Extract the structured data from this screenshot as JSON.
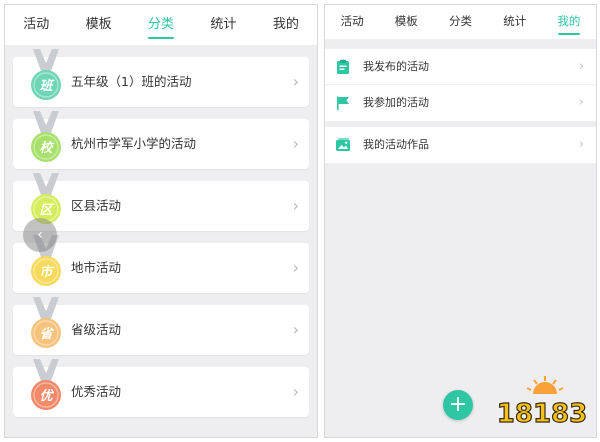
{
  "left_panel": {
    "tabs": [
      {
        "label": "活动"
      },
      {
        "label": "模板"
      },
      {
        "label": "分类",
        "active": true
      },
      {
        "label": "统计"
      },
      {
        "label": "我的"
      }
    ],
    "categories": [
      {
        "label": "五年级（1）班的活动",
        "badge": "班",
        "color": "#6ed6b6",
        "ribbon": "#c9ccd1"
      },
      {
        "label": "杭州市学军小学的活动",
        "badge": "校",
        "color": "#a7e06a",
        "ribbon": "#c9ccd1"
      },
      {
        "label": "区县活动",
        "badge": "区",
        "color": "#d6ec5f",
        "ribbon": "#c9ccd1"
      },
      {
        "label": "地市活动",
        "badge": "市",
        "color": "#f7d95b",
        "ribbon": "#c9ccd1"
      },
      {
        "label": "省级活动",
        "badge": "省",
        "color": "#f7c27c",
        "ribbon": "#c9ccd1"
      },
      {
        "label": "优秀活动",
        "badge": "优",
        "color": "#f28a6a",
        "ribbon": "#c9ccd1"
      }
    ],
    "chevron": "›",
    "handle_glyph": "‹"
  },
  "right_panel": {
    "tabs": [
      {
        "label": "活动"
      },
      {
        "label": "模板"
      },
      {
        "label": "分类"
      },
      {
        "label": "统计"
      },
      {
        "label": "我的",
        "active": true
      }
    ],
    "group1": [
      {
        "label": "我发布的活动",
        "icon": "clipboard-icon"
      },
      {
        "label": "我参加的活动",
        "icon": "flag-icon"
      }
    ],
    "group2": [
      {
        "label": "我的活动作品",
        "icon": "photo-gallery-icon"
      }
    ],
    "chevron": "›",
    "fab_glyph": "+"
  },
  "watermark": {
    "text": "18183"
  },
  "colors": {
    "accent": "#2fc6a3",
    "background": "#eeeef0",
    "text": "#333333"
  }
}
